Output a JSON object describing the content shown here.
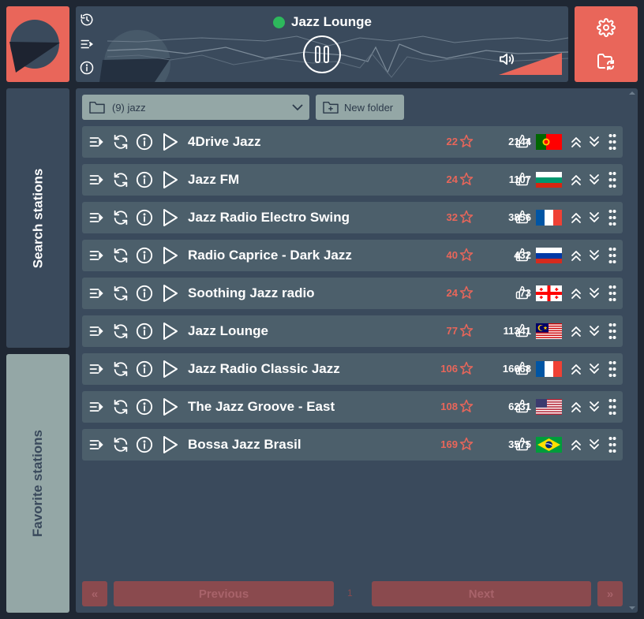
{
  "player": {
    "now_playing": "Jazz Lounge",
    "status_color": "#2db85c",
    "volume_level": 1.0
  },
  "folder": {
    "selected": "(9) jazz",
    "new_folder_label": "New folder"
  },
  "tabs": {
    "search": "Search stations",
    "favorite": "Favorite stations"
  },
  "stations": [
    {
      "name": "4Drive Jazz",
      "votes": "22",
      "likes": "2144",
      "flag": "portugal"
    },
    {
      "name": "Jazz FM",
      "votes": "24",
      "likes": "1107",
      "flag": "bulgaria"
    },
    {
      "name": "Jazz Radio Electro Swing",
      "votes": "32",
      "likes": "3856",
      "flag": "france"
    },
    {
      "name": "Radio Caprice - Dark Jazz",
      "votes": "40",
      "likes": "432",
      "flag": "russia"
    },
    {
      "name": "Soothing Jazz radio",
      "votes": "24",
      "likes": "73",
      "flag": "georgia"
    },
    {
      "name": "Jazz Lounge",
      "votes": "77",
      "likes": "11341",
      "flag": "malaysia"
    },
    {
      "name": "Jazz Radio Classic Jazz",
      "votes": "106",
      "likes": "16668",
      "flag": "france"
    },
    {
      "name": "The Jazz Groove - East",
      "votes": "108",
      "likes": "6231",
      "flag": "usa"
    },
    {
      "name": "Bossa Jazz Brasil",
      "votes": "169",
      "likes": "3575",
      "flag": "brazil"
    }
  ],
  "pagination": {
    "first": "«",
    "previous": "Previous",
    "page": "1",
    "next": "Next",
    "last": "»"
  },
  "colors": {
    "accent": "#e9665a",
    "panel": "#3a4a5c",
    "row": "#4c5f6b",
    "muted": "#94a7a6",
    "background": "#1f2733"
  },
  "icons": [
    "history-icon",
    "queue-icon",
    "info-icon",
    "pause-icon",
    "volume-icon",
    "gear-icon",
    "folder-sync-icon",
    "add-queue-icon",
    "refresh-icon",
    "play-icon",
    "star-icon",
    "thumbs-up-icon",
    "move-up-icon",
    "move-down-icon",
    "drag-handle-icon",
    "folder-icon",
    "chevron-down-icon",
    "folder-plus-icon"
  ]
}
